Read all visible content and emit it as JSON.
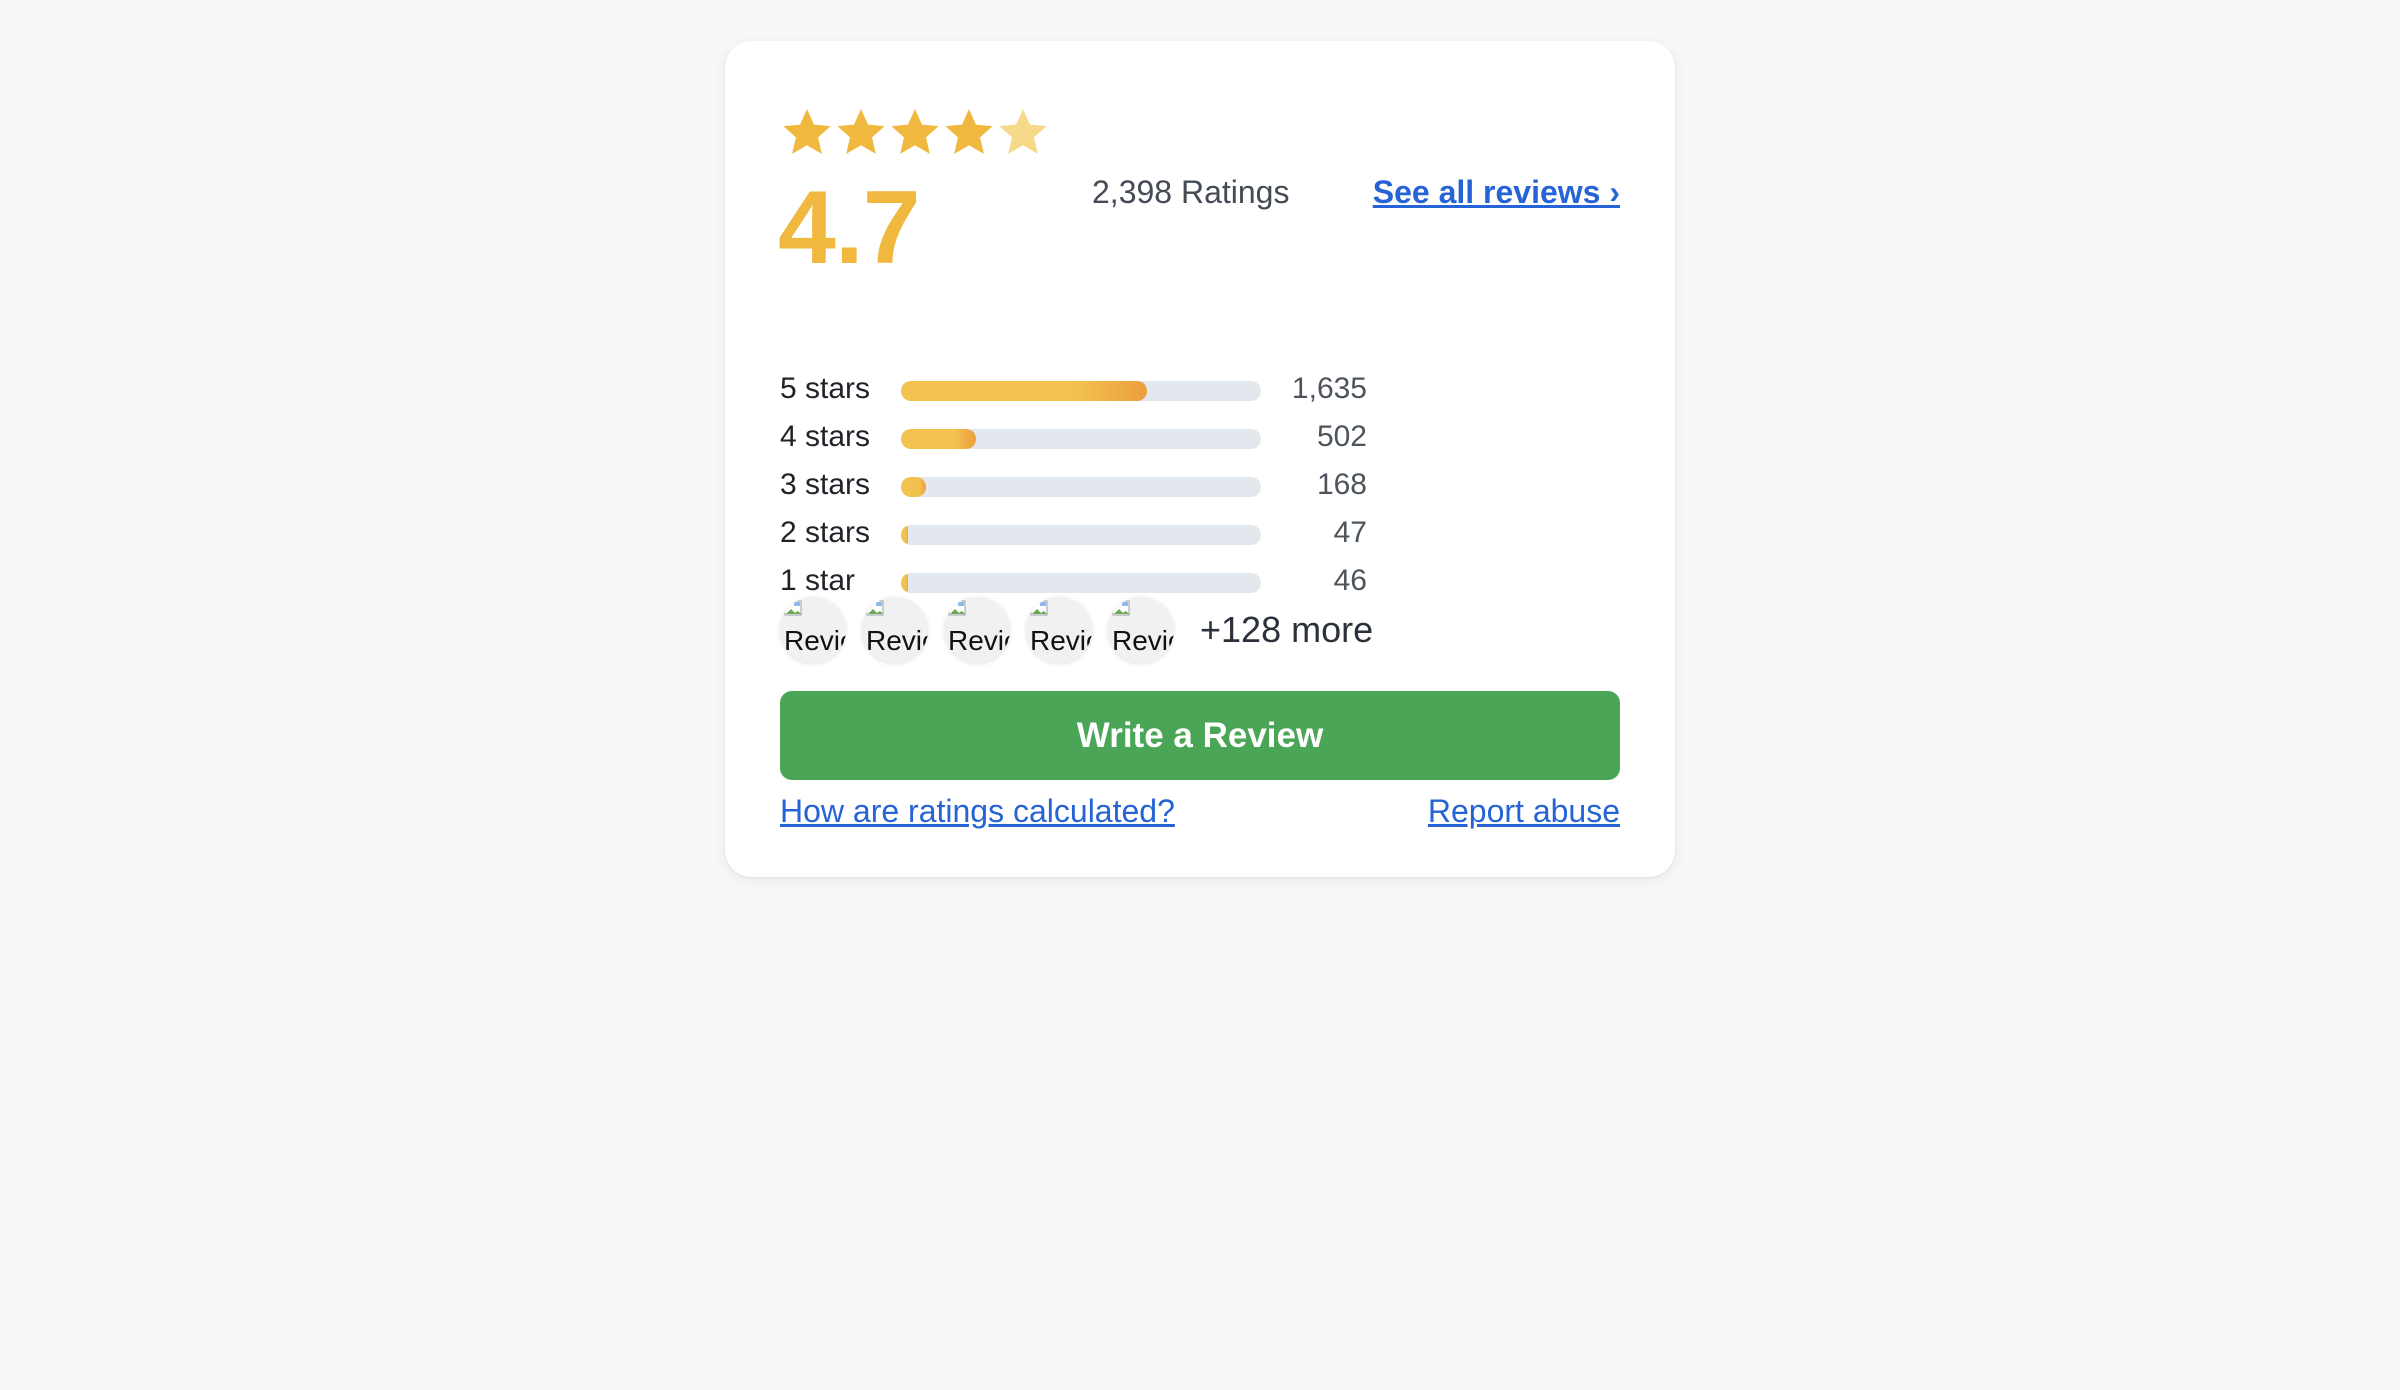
{
  "rating": {
    "average": "4.7",
    "stars_value": 4.7,
    "total_label": "2,398 Ratings",
    "see_all_label": "See all reviews ›"
  },
  "distribution": [
    {
      "label": "5 stars",
      "count": "1,635",
      "fraction": 0.682
    },
    {
      "label": "4 stars",
      "count": "502",
      "fraction": 0.209
    },
    {
      "label": "3 stars",
      "count": "168",
      "fraction": 0.07
    },
    {
      "label": "2 stars",
      "count": "47",
      "fraction": 0.02
    },
    {
      "label": "1 star",
      "count": "46",
      "fraction": 0.019
    }
  ],
  "photos": {
    "alt_text": "Review photo",
    "more_label": "+128 more"
  },
  "actions": {
    "write_review": "Write a Review",
    "how_calculated": "How are ratings calculated?",
    "report_abuse": "Report abuse"
  },
  "colors": {
    "star": "#f0b83e",
    "star_faded": "#f7d98a",
    "accent_button": "#4ba556",
    "link": "#2563d6",
    "bar_track": "#e3e8ee"
  }
}
